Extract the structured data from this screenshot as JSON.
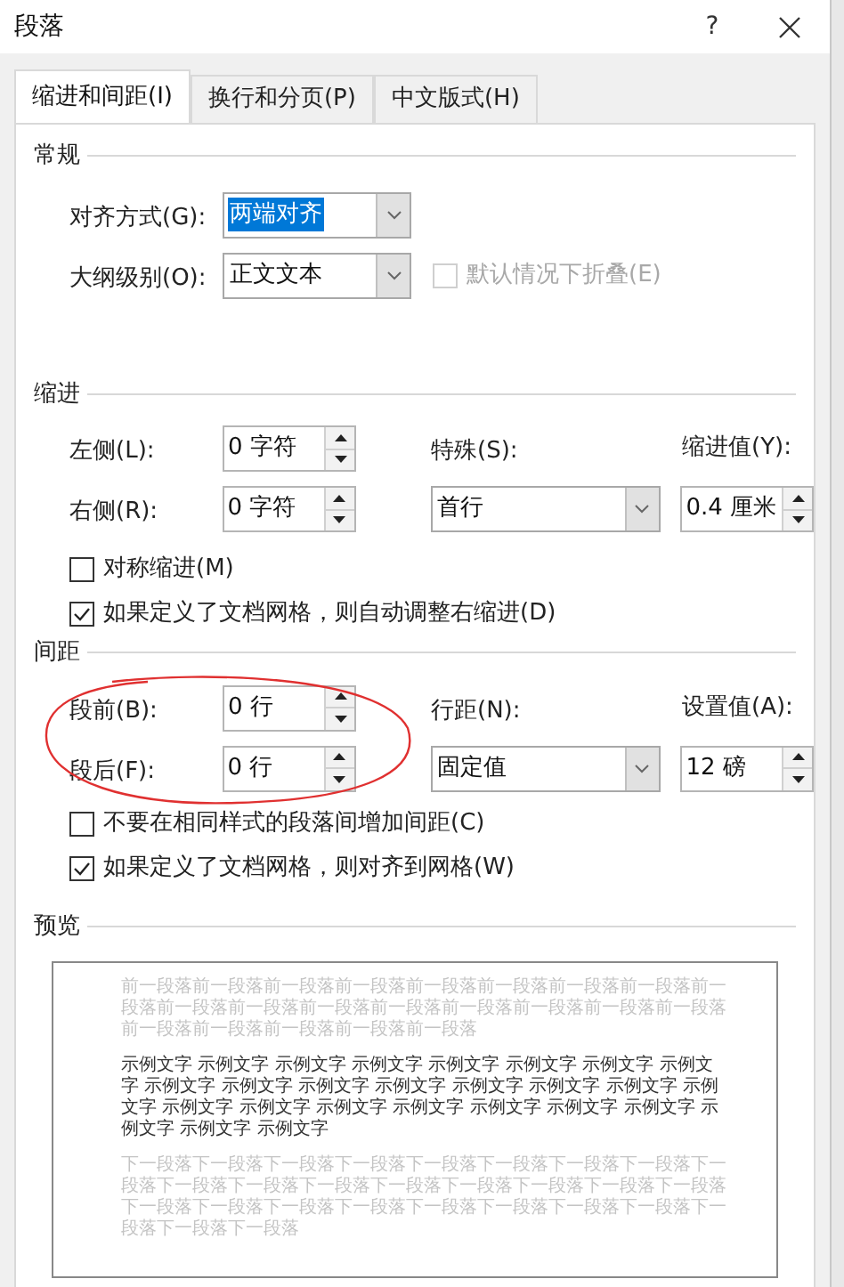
{
  "window": {
    "title": "段落",
    "help": "?"
  },
  "tabs": [
    {
      "label": "缩进和间距(I)",
      "selected": true
    },
    {
      "label": "换行和分页(P)",
      "selected": false
    },
    {
      "label": "中文版式(H)",
      "selected": false
    }
  ],
  "general": {
    "title": "常规",
    "alignment": {
      "label": "对齐方式(G):",
      "value": "两端对齐",
      "highlighted": true
    },
    "outline_level": {
      "label": "大纲级别(O):",
      "value": "正文文本",
      "highlighted": false
    },
    "collapse": {
      "label": "默认情况下折叠(E)",
      "checked": false,
      "disabled": true
    }
  },
  "indent": {
    "title": "缩进",
    "left": {
      "label": "左侧(L):",
      "value": "0 字符"
    },
    "right": {
      "label": "右侧(R):",
      "value": "0 字符"
    },
    "special": {
      "label": "特殊(S):",
      "value": "首行"
    },
    "by": {
      "label": "缩进值(Y):",
      "value": "0.4 厘米"
    },
    "checkboxes": [
      {
        "label": "对称缩进(M)",
        "checked": false,
        "disabled": false
      },
      {
        "label": "如果定义了文档网格，则自动调整右缩进(D)",
        "checked": true,
        "disabled": false
      }
    ]
  },
  "spacing": {
    "title": "间距",
    "before": {
      "label": "段前(B):",
      "value": "0 行"
    },
    "after": {
      "label": "段后(F):",
      "value": "0 行"
    },
    "line_spacing": {
      "label": "行距(N):",
      "value": "固定值"
    },
    "at": {
      "label": "设置值(A):",
      "value": "12 磅"
    },
    "checkboxes": [
      {
        "label": "不要在相同样式的段落间增加间距(C)",
        "checked": false,
        "disabled": false
      },
      {
        "label": "如果定义了文档网格，则对齐到网格(W)",
        "checked": true,
        "disabled": false
      }
    ]
  },
  "preview": {
    "title": "预览",
    "previous": "前一段落前一段落前一段落前一段落前一段落前一段落前一段落前一段落前一段落前一段落前一段落前一段落前一段落前一段落前一段落前一段落前一段落前一段落前一段落前一段落前一段落前一段落",
    "sample": "示例文字 示例文字 示例文字 示例文字 示例文字 示例文字 示例文字 示例文字 示例文字 示例文字 示例文字 示例文字 示例文字 示例文字 示例文字 示例文字 示例文字 示例文字 示例文字 示例文字 示例文字 示例文字 示例文字 示例文字 示例文字 示例文字",
    "next": "下一段落下一段落下一段落下一段落下一段落下一段落下一段落下一段落下一段落下一段落下一段落下一段落下一段落下一段落下一段落下一段落下一段落下一段落下一段落下一段落下一段落下一段落下一段落下一段落下一段落下一段落下一段落下一段落"
  }
}
